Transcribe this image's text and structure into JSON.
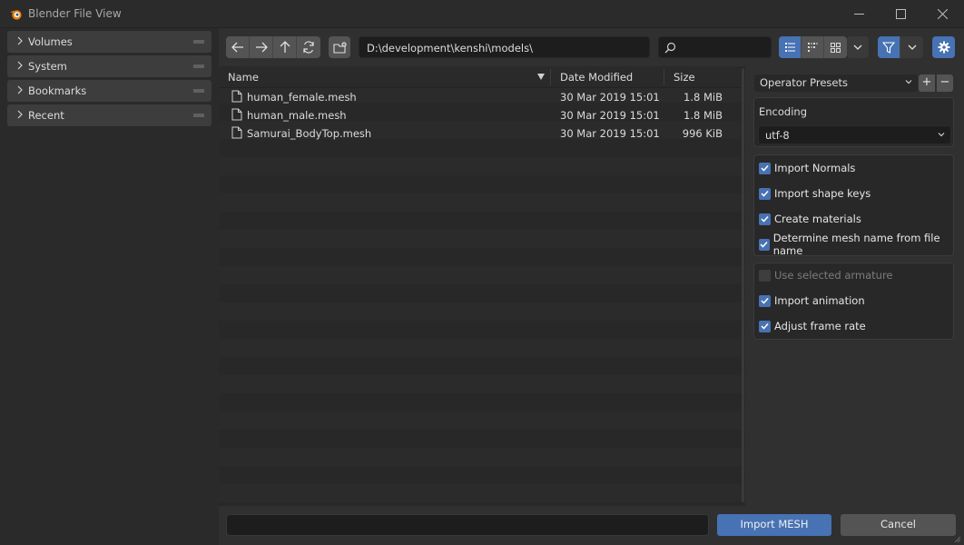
{
  "window": {
    "title": "Blender File View",
    "controls": {
      "minimize": "minimize-icon",
      "maximize": "maximize-icon",
      "close": "close-icon"
    }
  },
  "sidebar": {
    "panels": [
      {
        "label": "Volumes"
      },
      {
        "label": "System"
      },
      {
        "label": "Bookmarks"
      },
      {
        "label": "Recent"
      }
    ]
  },
  "toolbar": {
    "path": "D:\\development\\kenshi\\models\\",
    "search_value": "",
    "display_mode": "vertical-list",
    "filter_enabled": true
  },
  "filelist": {
    "columns": {
      "name": "Name",
      "date": "Date Modified",
      "size": "Size"
    },
    "sort_column": "name",
    "rows": [
      {
        "name": "human_female.mesh",
        "date": "30 Mar 2019 15:01",
        "size": "1.8 MiB"
      },
      {
        "name": "human_male.mesh",
        "date": "30 Mar 2019 15:01",
        "size": "1.8 MiB"
      },
      {
        "name": "Samurai_BodyTop.mesh",
        "date": "30 Mar 2019 15:01",
        "size": "996 KiB"
      }
    ]
  },
  "options": {
    "presets_label": "Operator Presets",
    "add_label": "+",
    "remove_label": "−",
    "encoding_label": "Encoding",
    "encoding_value": "utf-8",
    "group1": [
      {
        "label": "Import Normals",
        "checked": true,
        "enabled": true
      },
      {
        "label": "Import shape keys",
        "checked": true,
        "enabled": true
      },
      {
        "label": "Create materials",
        "checked": true,
        "enabled": true
      },
      {
        "label": "Determine mesh name from file name",
        "checked": true,
        "enabled": true
      }
    ],
    "group2": [
      {
        "label": "Use selected armature",
        "checked": false,
        "enabled": false
      },
      {
        "label": "Import animation",
        "checked": true,
        "enabled": true
      },
      {
        "label": "Adjust frame rate",
        "checked": true,
        "enabled": true
      }
    ]
  },
  "bottom": {
    "filename_value": "",
    "confirm_label": "Import MESH",
    "cancel_label": "Cancel"
  },
  "colors": {
    "accent": "#4772b3",
    "background": "#303030",
    "button": "#545454"
  }
}
